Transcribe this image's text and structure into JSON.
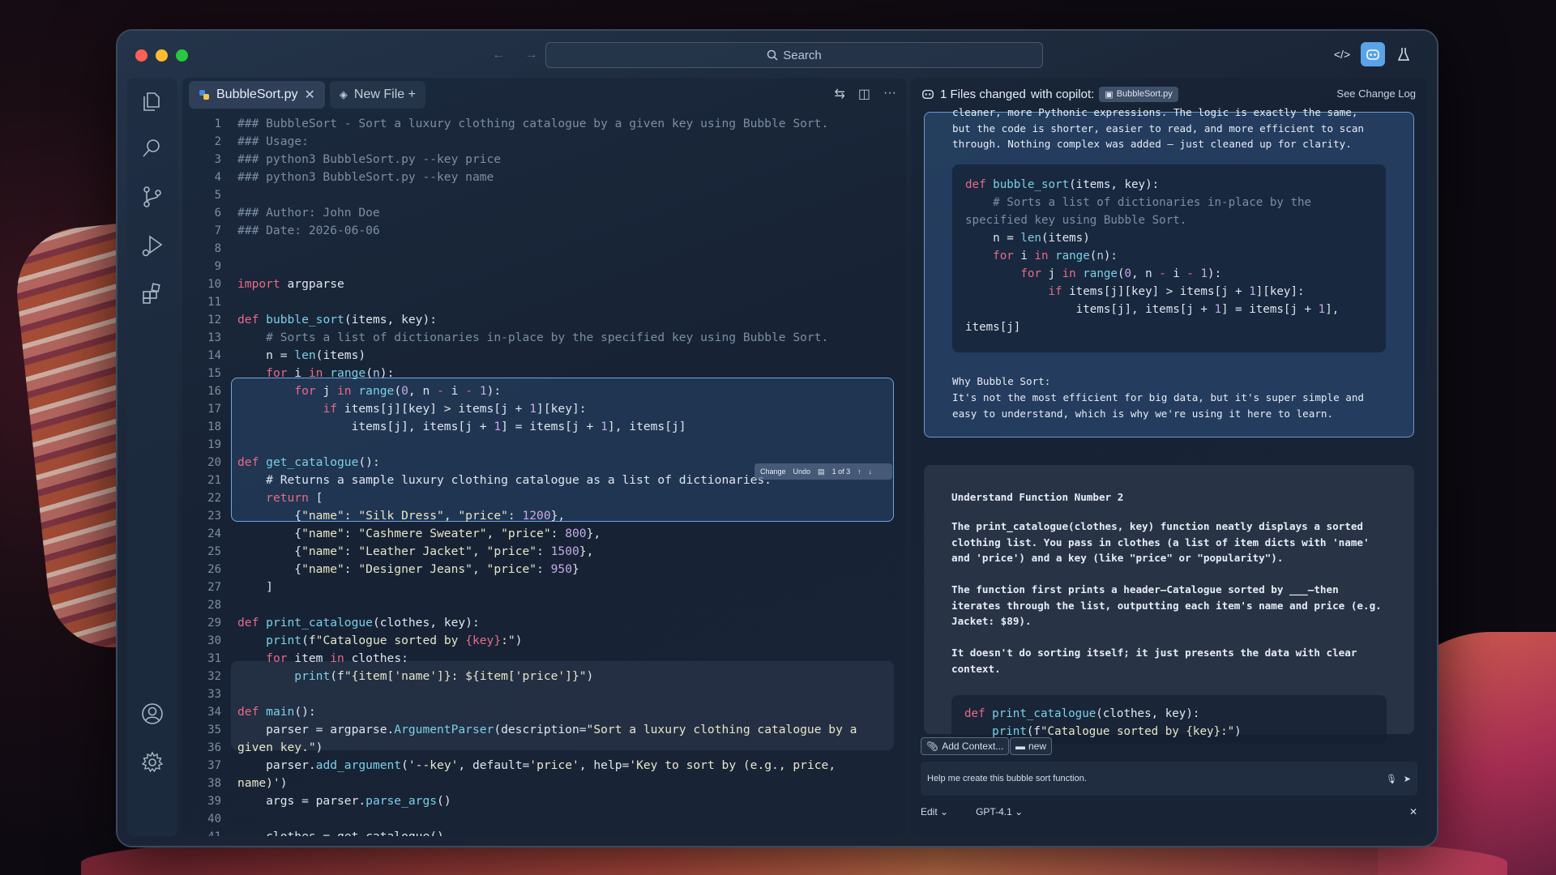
{
  "titlebar": {
    "search_placeholder": "Search",
    "nav_arrows": "← →"
  },
  "tabs": [
    {
      "label": "BubbleSort.py",
      "active": true
    },
    {
      "label": "New File +",
      "active": false
    }
  ],
  "code_lines": [
    {
      "n": "1",
      "html": "<span class='cm'>### BubbleSort - Sort a luxury clothing catalogue by a given key using Bubble Sort.</span>"
    },
    {
      "n": "2",
      "html": "<span class='cm'>### Usage:</span>"
    },
    {
      "n": "3",
      "html": "<span class='cm'>### python3 BubbleSort.py --key price</span>"
    },
    {
      "n": "4",
      "html": "<span class='cm'>### python3 BubbleSort.py --key name</span>"
    },
    {
      "n": "5",
      "html": ""
    },
    {
      "n": "6",
      "html": "<span class='cm'>### Author: John Doe</span>"
    },
    {
      "n": "7",
      "html": "<span class='cm'>### Date: 2026-06-06</span>"
    },
    {
      "n": "8",
      "html": ""
    },
    {
      "n": "9",
      "html": ""
    },
    {
      "n": "10",
      "html": "<span class='kw'>import</span> argparse"
    },
    {
      "n": "11",
      "html": ""
    },
    {
      "n": "12",
      "html": "<span class='kw'>def</span> <span class='fn'>bubble_sort</span>(items, key):"
    },
    {
      "n": "13",
      "html": "    <span class='cm'># Sorts a list of dictionaries in-place by the specified key using Bubble Sort.</span>"
    },
    {
      "n": "14",
      "html": "    n = <span class='fn'>len</span>(items)"
    },
    {
      "n": "15",
      "html": "    <span class='kw'>for</span> i <span class='kw'>in</span> <span class='fn'>range</span>(<span class='var'>n</span>):"
    },
    {
      "n": "16",
      "html": "        <span class='kw'>for</span> j <span class='kw'>in</span> <span class='fn'>range</span>(<span class='num'>0</span>, n <span class='kw'>-</span> i <span class='kw'>-</span> <span class='num'>1</span>):"
    },
    {
      "n": "17",
      "html": "            <span class='kw'>if</span> items[j][key] > items[j + <span class='num'>1</span>][key]:"
    },
    {
      "n": "18",
      "html": "                items[j], items[j + <span class='num'>1</span>] = items[j + <span class='num'>1</span>], items[j]"
    },
    {
      "n": "19",
      "html": ""
    },
    {
      "n": "20",
      "html": "<span class='kw'>def</span> <span class='fn'>get_catalogue</span>():"
    },
    {
      "n": "21",
      "html": "    # Returns a sample luxury clothing catalogue as a list of dictionaries."
    },
    {
      "n": "22",
      "html": "    <span class='kw'>return</span> ["
    },
    {
      "n": "23",
      "html": "        {<span class='str'>\"name\"</span>: <span class='str'>\"Silk Dress\"</span>, <span class='str'>\"price\"</span>: <span class='num'>1200</span>},"
    },
    {
      "n": "24",
      "html": "        {<span class='str'>\"name\"</span>: <span class='str'>\"Cashmere Sweater\"</span>, <span class='str'>\"price\"</span>: <span class='num'>800</span>},"
    },
    {
      "n": "25",
      "html": "        {<span class='str'>\"name\"</span>: <span class='str'>\"Leather Jacket\"</span>, <span class='str'>\"price\"</span>: <span class='num'>1500</span>},"
    },
    {
      "n": "26",
      "html": "        {<span class='str'>\"name\"</span>: <span class='str'>\"Designer Jeans\"</span>, <span class='str'>\"price\"</span>: <span class='num'>950</span>}"
    },
    {
      "n": "27",
      "html": "    ]"
    },
    {
      "n": "28",
      "html": ""
    },
    {
      "n": "29",
      "html": "<span class='kw'>def</span> <span class='fn'>print_catalogue</span>(clothes, key):"
    },
    {
      "n": "30",
      "html": "    <span class='fn'>print</span>(f<span class='str'>\"Catalogue sorted by </span><span class='kw'>{key}</span><span class='str'>:\"</span>)"
    },
    {
      "n": "31",
      "html": "    <span class='kw'>for</span> item <span class='kw'>in</span> clothes:"
    },
    {
      "n": "32",
      "html": "        <span class='fn'>print</span>(f<span class='str'>\"{item['name']}: ${item['price']}\"</span>)"
    },
    {
      "n": "33",
      "html": ""
    },
    {
      "n": "34",
      "html": "<span class='kw'>def</span> <span class='fn'>main</span>():"
    },
    {
      "n": "35",
      "html": "    parser = argparse.<span class='fn'>ArgumentParser</span>(description=<span class='str'>\"Sort a luxury clothing catalogue by a</span>"
    },
    {
      "n": "36",
      "html": "<span class='str'>given key.\"</span>)"
    },
    {
      "n": "37",
      "html": "    parser.<span class='fn'>add_argument</span>(<span class='str'>'--key'</span>, default=<span class='str'>'price'</span>, help=<span class='str'>'Key to sort by (e.g., price,</span>"
    },
    {
      "n": "38",
      "html": "<span class='str'>name)'</span>)"
    },
    {
      "n": "39",
      "html": "    args = parser.<span class='fn'>parse_args</span>()"
    },
    {
      "n": "40",
      "html": ""
    },
    {
      "n": "41",
      "html": "    clothes = get_catalogue()"
    }
  ],
  "change_bar": {
    "change": "Change",
    "undo": "Undo",
    "count": "1 of 3"
  },
  "panel": {
    "header_text": "1 Files changed",
    "with_copilot": "with copilot:",
    "file_chip": "BubbleSort.py",
    "see_change_log": "See Change Log",
    "msg1_intro": "cleaner, more Pythonic expressions. The logic is exactly the same, but the code is shorter, easier to read, and more efficient to scan through. Nothing complex was added — just cleaned up for clarity.",
    "msg1_why_title": "Why Bubble Sort:",
    "msg1_why_text": "It's not the most efficient for big data, but it's super simple and easy to understand, which is why we're using it here to learn.",
    "msg2_title": "Understand Function Number 2",
    "msg2_p1": "The print_catalogue(clothes, key) function neatly displays a sorted clothing list. You pass in clothes (a list of item dicts with 'name' and 'price') and a key (like \"price\" or \"popularity\").",
    "msg2_p2": "The function first prints a header—Catalogue sorted by ___—then iterates through the list, outputting each item's name and price (e.g. Jacket: $89).",
    "msg2_p3": "It doesn't do sorting itself; it just presents the data with clear context.",
    "msg2_code_l1": "def print_catalogue(clothes, key):",
    "msg2_code_l2": "    print(f\"Catalogue sorted by {key}:\")",
    "add_context": "Add Context...",
    "new_label": "new",
    "prompt_text": "Help me create this bubble sort function.",
    "mode": "Edit",
    "model": "GPT-4.1"
  }
}
